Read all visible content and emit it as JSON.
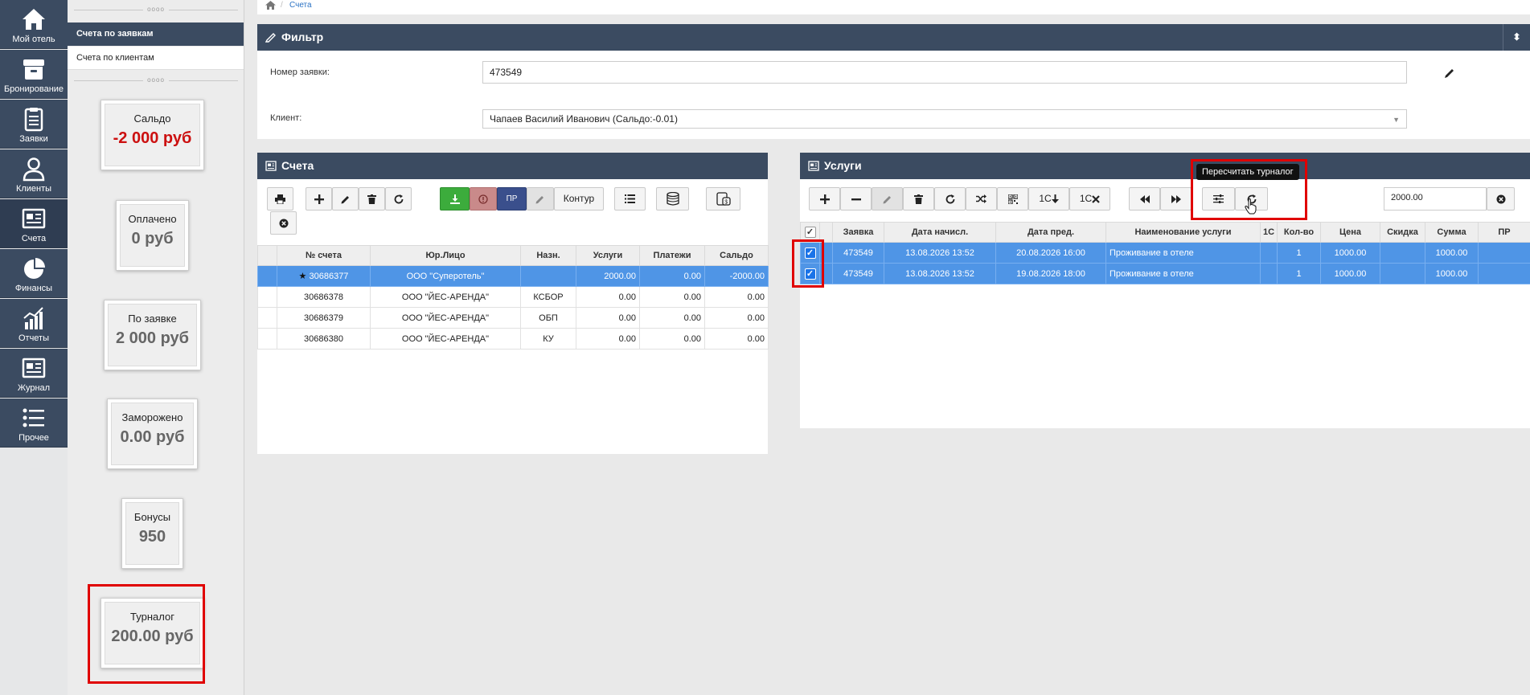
{
  "nav": {
    "items": [
      {
        "label": "Мой отель",
        "icon": "home-icon"
      },
      {
        "label": "Бронирование",
        "icon": "box-icon"
      },
      {
        "label": "Заявки",
        "icon": "clipboard-icon"
      },
      {
        "label": "Клиенты",
        "icon": "user-icon"
      },
      {
        "label": "Счета",
        "icon": "invoice-icon"
      },
      {
        "label": "Финансы",
        "icon": "pie-chart-icon"
      },
      {
        "label": "Отчеты",
        "icon": "bar-chart-icon"
      },
      {
        "label": "Журнал",
        "icon": "journal-icon"
      },
      {
        "label": "Прочее",
        "icon": "list-icon"
      }
    ],
    "active_index": 4
  },
  "subnav": {
    "items": [
      {
        "label": "Счета по заявкам"
      },
      {
        "label": "Счета по клиентам"
      }
    ],
    "handle_dots": "oooo"
  },
  "stats": [
    {
      "title": "Сальдо",
      "value": "-2 000 руб"
    },
    {
      "title": "Оплачено",
      "value": "0 руб"
    },
    {
      "title": "По заявке",
      "value": "2 000 руб"
    },
    {
      "title": "Заморожено",
      "value": "0.00 руб"
    },
    {
      "title": "Бонусы",
      "value": "950"
    },
    {
      "title": "Турналог",
      "value": "200.00 руб"
    }
  ],
  "breadcrumb": {
    "current": "Счета",
    "separator": "/"
  },
  "filter": {
    "title": "Фильтр",
    "order_label": "Номер заявки:",
    "order_value": "473549",
    "client_label": "Клиент:",
    "client_value": "Чапаев Василий Иванович (Сальдо:-0.01)"
  },
  "invoices": {
    "title": "Счета",
    "toolbar": {
      "pr_label": "ПР",
      "kontur_label": "Контур"
    },
    "columns": [
      "№ счета",
      "Юр.Лицо",
      "Назн.",
      "Услуги",
      "Платежи",
      "Сальдо"
    ],
    "rows": [
      {
        "number": "30686377",
        "starred": true,
        "legal": "ООО \"Суперотель\"",
        "purpose": "",
        "services": "2000.00",
        "payments": "0.00",
        "balance": "-2000.00",
        "selected": true
      },
      {
        "number": "30686378",
        "starred": false,
        "legal": "ООО \"ЙЕС-АРЕНДА\"",
        "purpose": "КСБОР",
        "services": "0.00",
        "payments": "0.00",
        "balance": "0.00",
        "selected": false
      },
      {
        "number": "30686379",
        "starred": false,
        "legal": "ООО \"ЙЕС-АРЕНДА\"",
        "purpose": "ОБП",
        "services": "0.00",
        "payments": "0.00",
        "balance": "0.00",
        "selected": false
      },
      {
        "number": "30686380",
        "starred": false,
        "legal": "ООО \"ЙЕС-АРЕНДА\"",
        "purpose": "КУ",
        "services": "0.00",
        "payments": "0.00",
        "balance": "0.00",
        "selected": false
      }
    ]
  },
  "services": {
    "title": "Услуги",
    "toolbar": {
      "onec_down_label": "1C",
      "onec_x_label": "1C",
      "amount_value": "2000.00"
    },
    "tooltip": "Пересчитать турналог",
    "columns": [
      "Заявка",
      "Дата начисл.",
      "Дата пред.",
      "Наименование услуги",
      "1С",
      "Кол-во",
      "Цена",
      "Скидка",
      "Сумма",
      "ПР"
    ],
    "rows": [
      {
        "order": "473549",
        "accrual": "13.08.2026 13:52",
        "provided": "20.08.2026 16:00",
        "name": "Проживание в отеле",
        "onec": "",
        "qty": "1",
        "price": "1000.00",
        "discount": "",
        "sum": "1000.00",
        "pr": ""
      },
      {
        "order": "473549",
        "accrual": "13.08.2026 13:52",
        "provided": "19.08.2026 18:00",
        "name": "Проживание в отеле",
        "onec": "",
        "qty": "1",
        "price": "1000.00",
        "discount": "",
        "sum": "1000.00",
        "pr": ""
      }
    ]
  },
  "colors": {
    "nav_bg": "#3b4b61",
    "selected_row": "#4f95e6",
    "negative": "#cc1010",
    "highlight": "#e00000"
  }
}
